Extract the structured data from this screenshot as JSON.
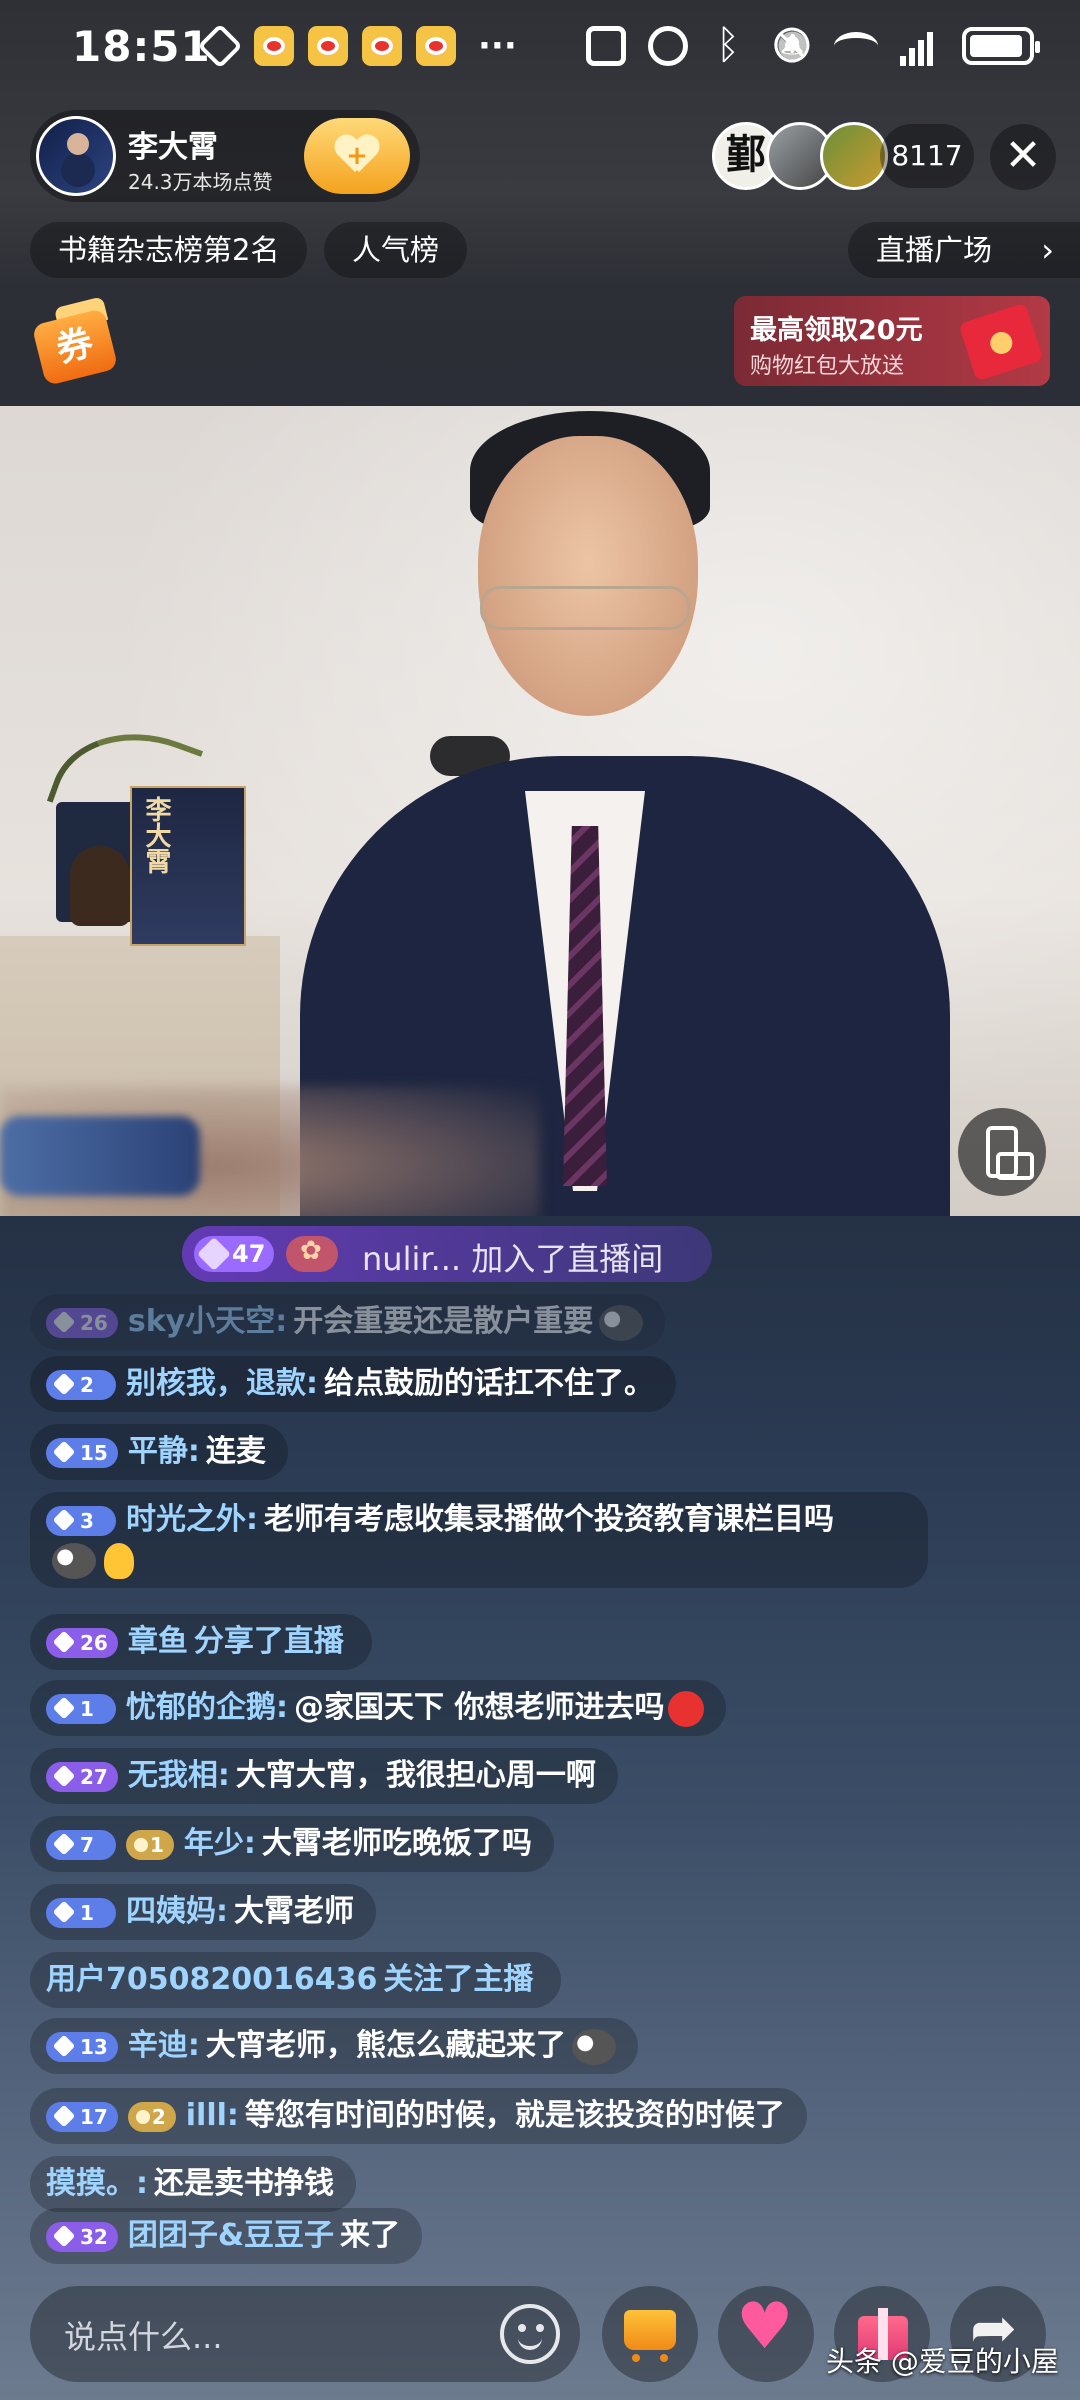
{
  "status_bar": {
    "time": "18:51",
    "more": "···"
  },
  "host": {
    "name": "李大霄",
    "likes": "24.3万本场点赞",
    "viewer_avatar_1_char": "鄞",
    "viewer_count": "8117"
  },
  "tags": {
    "rank": "书籍杂志榜第2名",
    "popularity": "人气榜",
    "plaza": "直播广场"
  },
  "coupon": {
    "label": "券"
  },
  "red_packet": {
    "title": "最高领取20元",
    "subtitle": "购物红包大放送"
  },
  "video": {
    "book_title": "李大霄"
  },
  "join_notice": {
    "level": "47",
    "text": "nulir... 加入了直播间"
  },
  "chat": [
    {
      "level": "26",
      "user": "sky小天空:",
      "text": "开会重要还是散户重要"
    },
    {
      "level": "2",
      "user": "别核我，退款:",
      "text": "给点鼓励的话扛不住了。"
    },
    {
      "level": "15",
      "user": "平静:",
      "text": "连麦"
    },
    {
      "level": "3",
      "user": "时光之外:",
      "text": "老师有考虑收集录播做个投资教育课栏目吗"
    },
    {
      "level": "26",
      "user": "章鱼",
      "text": "分享了直播"
    },
    {
      "level": "1",
      "user": "忧郁的企鹅:",
      "text": "@家国天下 你想老师进去吗"
    },
    {
      "level": "27",
      "user": "无我相:",
      "text": "大宵大宵，我很担心周一啊"
    },
    {
      "level": "7",
      "fan_level": "1",
      "user": "年少:",
      "text": "大霄老师吃晚饭了吗"
    },
    {
      "level": "1",
      "user": "四姨妈:",
      "text": "大霄老师"
    },
    {
      "user": "用户7050820016436",
      "text": "关注了主播"
    },
    {
      "level": "13",
      "user": "辛迪:",
      "text": "大宵老师，熊怎么藏起来了"
    },
    {
      "level": "17",
      "fan_level": "2",
      "user": "illl:",
      "text": "等您有时间的时候，就是该投资的时候了"
    },
    {
      "user": "摸摸。:",
      "text": "还是卖书挣钱"
    },
    {
      "level": "32",
      "user": "团团子&豆豆子",
      "text": "来了"
    }
  ],
  "bottom_bar": {
    "input_placeholder": "说点什么..."
  },
  "watermark": "头条 @爱豆的小屋"
}
